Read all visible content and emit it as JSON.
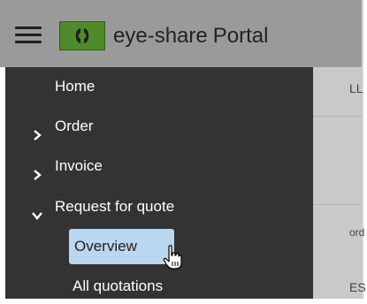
{
  "header": {
    "brand_name": "eye-share",
    "brand_suffix": "Portal",
    "brand_color": "#4f8a2b",
    "header_color": "#9a9a9a"
  },
  "sidebar": {
    "background": "#333333",
    "items": [
      {
        "label": "Home",
        "icon": "none"
      },
      {
        "label": "Order",
        "icon": "chevron-right-icon"
      },
      {
        "label": "Invoice",
        "icon": "chevron-right-icon"
      },
      {
        "label": "Request for quote",
        "icon": "chevron-down-icon",
        "expanded": true
      }
    ],
    "sub_items": [
      {
        "label": "Overview",
        "active": true,
        "active_color": "#b9d7ee"
      },
      {
        "label": "All quotations",
        "active": false
      }
    ]
  },
  "content_peek": {
    "texts": [
      "LL",
      "ord",
      "ES"
    ]
  }
}
